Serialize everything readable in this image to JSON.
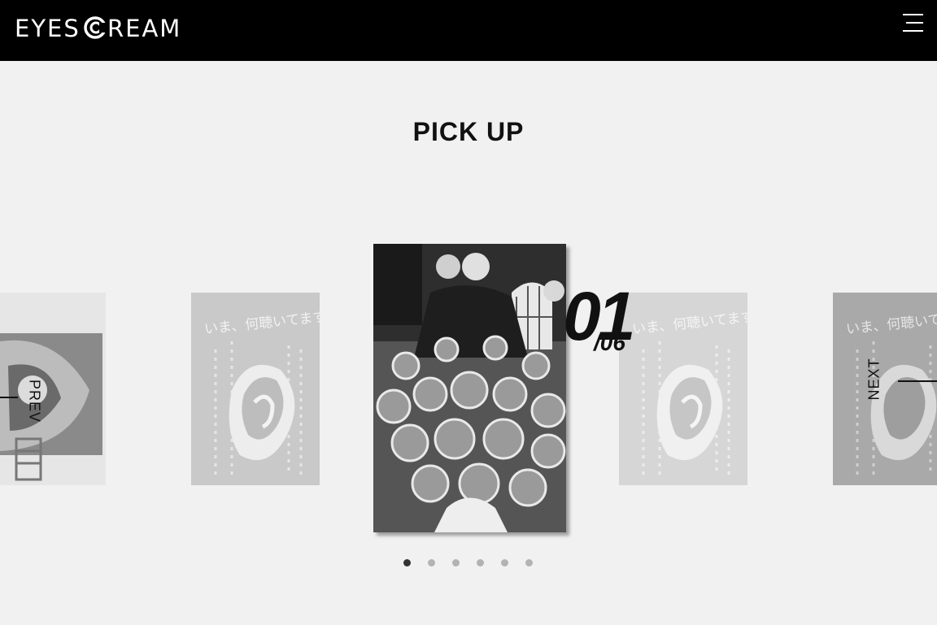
{
  "header": {
    "logo_text": "EYESCREAM",
    "background": "#000000"
  },
  "section": {
    "title": "PICK UP"
  },
  "slider": {
    "current": "01",
    "total": "/06",
    "prev_label": "PREV",
    "next_label": "NEXT",
    "slide_caption": "いま、何聴いてますか?",
    "dot_count": 6,
    "active_dot": 1
  }
}
